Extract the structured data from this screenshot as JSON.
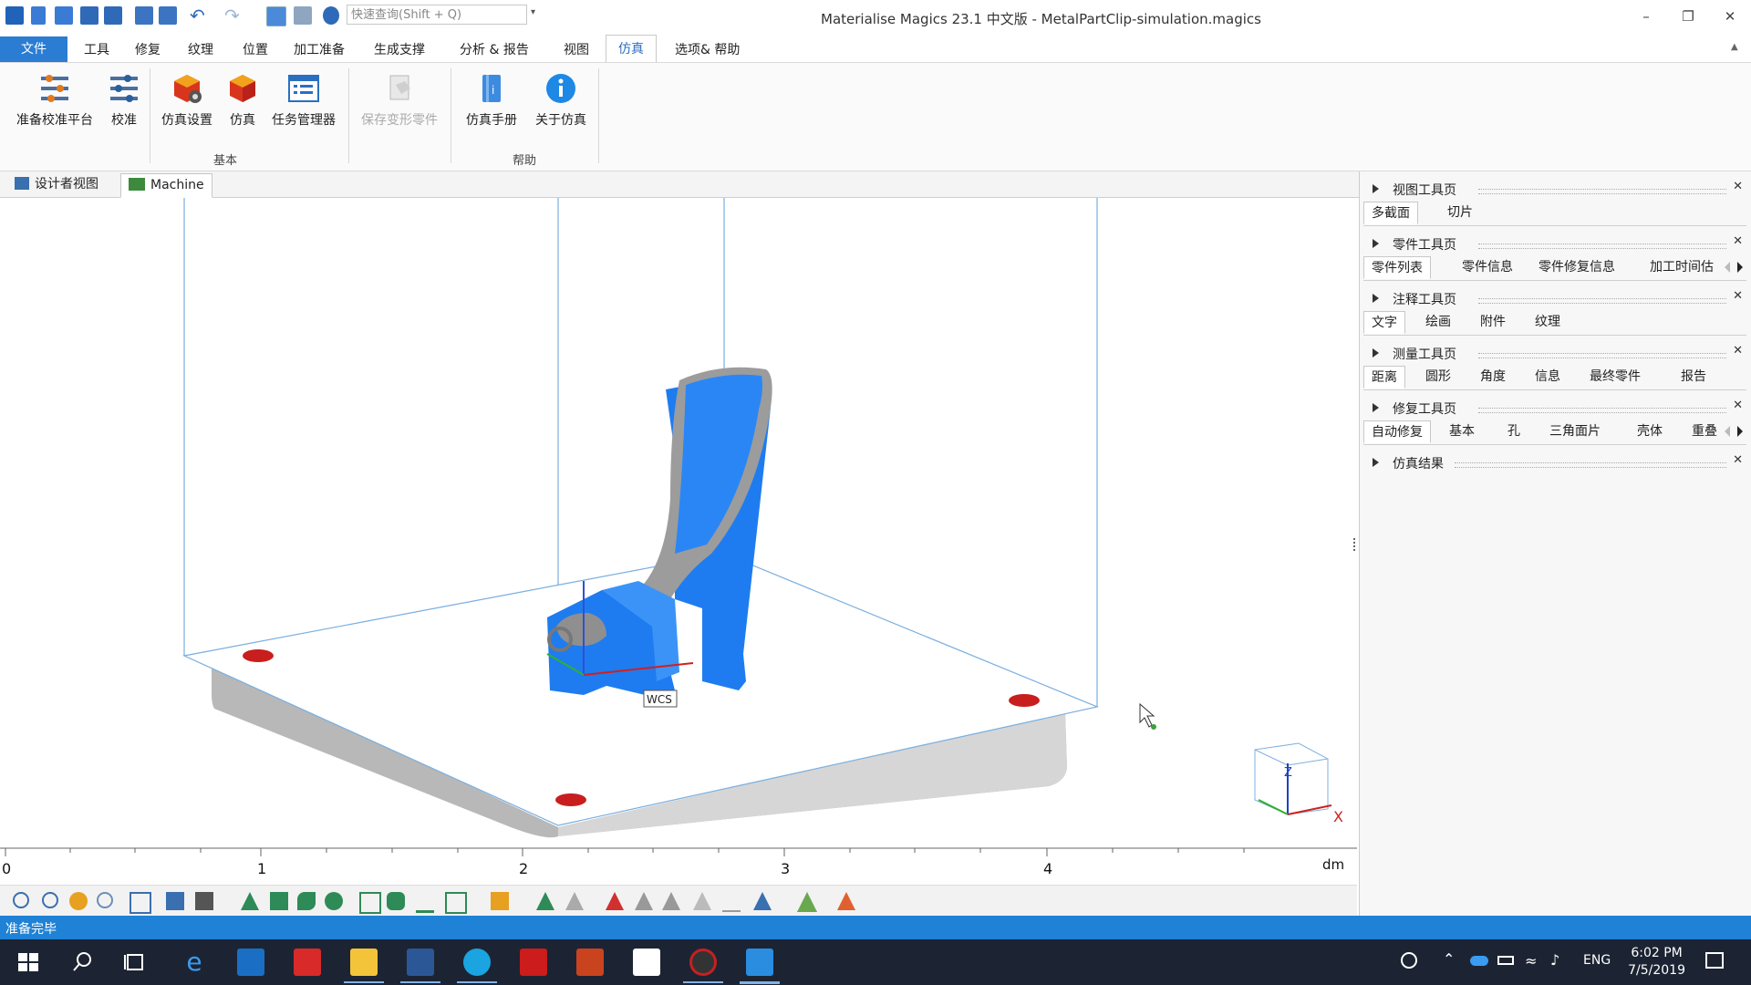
{
  "app": {
    "title": "Materialise Magics 23.1 中文版 - MetalPartClip-simulation.magics",
    "search_placeholder": "快速查询(Shift + Q)"
  },
  "menu": {
    "file": "文件",
    "items": [
      "工具",
      "修复",
      "纹理",
      "位置",
      "加工准备",
      "生成支撑",
      "分析 & 报告",
      "视图"
    ],
    "active": "仿真",
    "help": "选项& 帮助"
  },
  "ribbon": {
    "buttons": [
      "准备校准平台",
      "校准",
      "仿真设置",
      "仿真",
      "任务管理器",
      "保存变形零件",
      "仿真手册",
      "关于仿真"
    ],
    "groups": {
      "basic": "基本",
      "help": "帮助"
    }
  },
  "view_tabs": [
    "设计者视图",
    "Machine"
  ],
  "viewport": {
    "wcs_label": "WCS",
    "axis_x": "X",
    "axis_z": "Z"
  },
  "ruler": {
    "ticks": [
      "0",
      "1",
      "2",
      "3",
      "4"
    ],
    "unit": "dm"
  },
  "status": {
    "text": "准备完毕"
  },
  "right_panel": {
    "sections": [
      {
        "title": "视图工具页",
        "tabs": [
          "多截面",
          "切片"
        ]
      },
      {
        "title": "零件工具页",
        "tabs": [
          "零件列表",
          "零件信息",
          "零件修复信息",
          "加工时间估"
        ]
      },
      {
        "title": "注释工具页",
        "tabs": [
          "文字",
          "绘画",
          "附件",
          "纹理"
        ]
      },
      {
        "title": "测量工具页",
        "tabs": [
          "距离",
          "圆形",
          "角度",
          "信息",
          "最终零件",
          "报告"
        ]
      },
      {
        "title": "修复工具页",
        "tabs": [
          "自动修复",
          "基本",
          "孔",
          "三角面片",
          "壳体",
          "重叠"
        ]
      },
      {
        "title": "仿真结果",
        "tabs": []
      }
    ]
  },
  "taskbar": {
    "lang": "ENG",
    "time": "6:02 PM",
    "date": "7/5/2019"
  },
  "colors": {
    "accent": "#2b7cd3",
    "status_bar": "#1f82d6",
    "part_blue": "#1e7cf0",
    "taskbar": "#1c2433"
  }
}
